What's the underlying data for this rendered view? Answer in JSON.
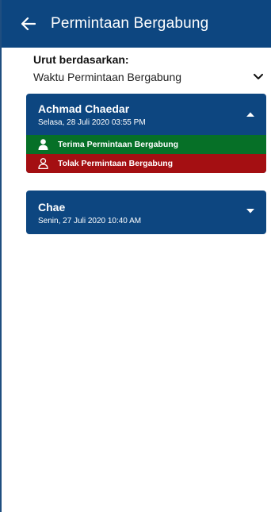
{
  "appbar": {
    "back_icon": "arrow-left-icon",
    "title": "Permintaan Bergabung",
    "background": "#0d4680"
  },
  "sort": {
    "label": "Urut berdasarkan:",
    "selected": "Waktu Permintaan Bergabung",
    "icon": "chevron-down-icon"
  },
  "requests": [
    {
      "name": "Achmad Chaedar",
      "date": "Selasa, 28 Juli 2020 03:55 PM",
      "expanded": true,
      "accept_label": "Terima Permintaan Bergabung",
      "reject_label": "Tolak Permintaan Bergabung"
    },
    {
      "name": "Chae",
      "date": "Senin, 27 Juli 2020 10:40 AM",
      "expanded": false
    }
  ],
  "colors": {
    "primary": "#0d4680",
    "accept": "#067027",
    "reject": "#a40f12"
  }
}
